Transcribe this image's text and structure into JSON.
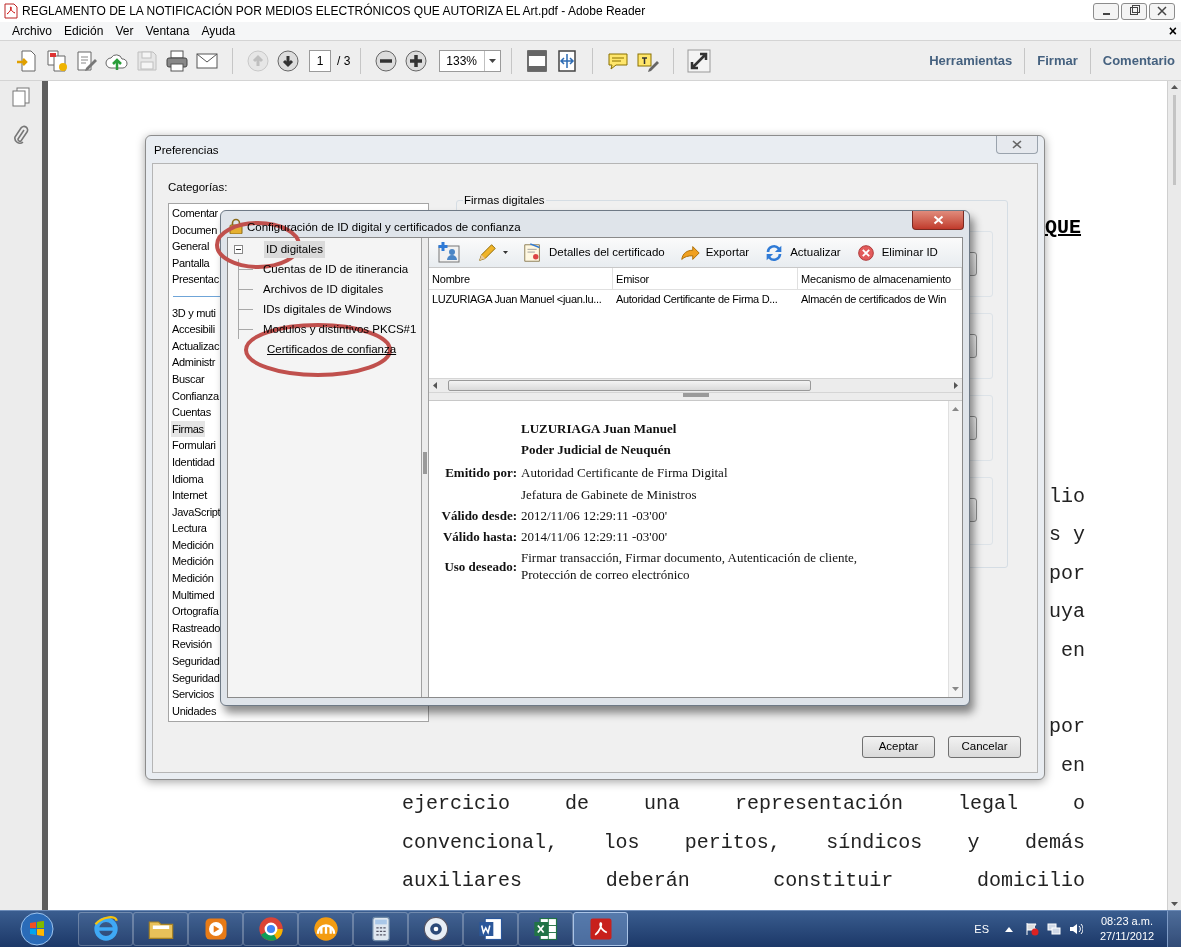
{
  "window": {
    "title": "REGLAMENTO DE LA NOTIFICACIÓN POR MEDIOS ELECTRÓNICOS QUE AUTORIZA EL Art.pdf - Adobe Reader"
  },
  "menu": [
    "Archivo",
    "Edición",
    "Ver",
    "Ventana",
    "Ayuda"
  ],
  "menu_close": "×",
  "toolbar": {
    "tools": [
      {
        "kind": "create",
        "disabled": false
      },
      {
        "kind": "combine",
        "disabled": false
      },
      {
        "kind": "edit",
        "disabled": false
      },
      {
        "kind": "share",
        "disabled": false
      },
      {
        "kind": "save",
        "disabled": true
      },
      {
        "kind": "print",
        "disabled": false
      },
      {
        "kind": "email",
        "disabled": false
      },
      {
        "kind": "prev",
        "disabled": true
      },
      {
        "kind": "next",
        "disabled": false
      },
      {
        "kind": "zoom_out",
        "disabled": false
      },
      {
        "kind": "zoom_in",
        "disabled": false
      },
      {
        "kind": "fit_page",
        "disabled": false
      },
      {
        "kind": "fit_width",
        "disabled": false
      },
      {
        "kind": "comment",
        "disabled": false
      },
      {
        "kind": "highlight",
        "disabled": false
      },
      {
        "kind": "fullscreen",
        "disabled": false
      }
    ],
    "page": "1",
    "page_count": "/ 3",
    "zoom": "133%",
    "panels": [
      "Herramientas",
      "Firmar",
      "Comentario"
    ]
  },
  "document": {
    "heading": "QUE",
    "lines": [
      {
        "kind": "fragment",
        "text": "lio"
      },
      {
        "kind": "fragment",
        "text": "s y"
      },
      {
        "kind": "fragment",
        "text": "por"
      },
      {
        "kind": "fragment",
        "text": "uya"
      },
      {
        "kind": "fragment",
        "text": "en"
      },
      {
        "kind": "blank"
      },
      {
        "kind": "fragment",
        "text": "por"
      },
      {
        "kind": "fragment",
        "text": "en"
      },
      {
        "kind": "line",
        "text": "ejercicio de una representación legal o"
      },
      {
        "kind": "line",
        "text": "convencional, los peritos, síndicos y demás"
      },
      {
        "kind": "line",
        "text": "auxiliares deberán constituir domicilio"
      }
    ]
  },
  "preferences": {
    "title": "Preferencias",
    "categories_label": "Categorías:",
    "category_groups": [
      {
        "items": [
          {
            "label": "Comentar",
            "selected": false
          },
          {
            "label": "Documen",
            "selected": false
          },
          {
            "label": "General",
            "selected": false
          },
          {
            "label": "Pantalla",
            "selected": false
          },
          {
            "label": "Presentac",
            "selected": false
          }
        ]
      },
      {
        "items": [
          {
            "label": "3D y muti",
            "selected": false
          },
          {
            "label": "Accesibili",
            "selected": false
          },
          {
            "label": "Actualizac",
            "selected": false
          },
          {
            "label": "Administr",
            "selected": false
          },
          {
            "label": "Buscar",
            "selected": false
          },
          {
            "label": "Confianza",
            "selected": false
          },
          {
            "label": "Cuentas",
            "selected": false
          },
          {
            "label": "Firmas",
            "selected": true
          },
          {
            "label": "Formulari",
            "selected": false
          },
          {
            "label": "Identidad",
            "selected": false
          },
          {
            "label": "Idioma",
            "selected": false
          },
          {
            "label": "Internet",
            "selected": false
          },
          {
            "label": "JavaScript",
            "selected": false
          },
          {
            "label": "Lectura",
            "selected": false
          },
          {
            "label": "Medición",
            "selected": false
          },
          {
            "label": "Medición",
            "selected": false
          },
          {
            "label": "Medición",
            "selected": false
          },
          {
            "label": "Multimed",
            "selected": false
          },
          {
            "label": "Ortografía",
            "selected": false
          },
          {
            "label": "Rastreado",
            "selected": false
          },
          {
            "label": "Revisión",
            "selected": false
          },
          {
            "label": "Seguridad",
            "selected": false
          },
          {
            "label": "Seguridad",
            "selected": false
          },
          {
            "label": "Servicios",
            "selected": false
          },
          {
            "label": "Unidades",
            "selected": false
          }
        ]
      }
    ],
    "group_title": "Firmas digitales",
    "buttons": [
      "Aceptar",
      "Cancelar"
    ]
  },
  "id_dialog": {
    "title": "Configuración de ID digital y certificados de confianza",
    "tree": [
      {
        "label": "ID digitales",
        "selected": true,
        "hovered": false,
        "expanded": true,
        "children": [
          {
            "label": "Cuentas de ID de itinerancia",
            "selected": false,
            "hovered": false
          },
          {
            "label": "Archivos de ID digitales",
            "selected": false,
            "hovered": false
          },
          {
            "label": "IDs digitales de Windows",
            "selected": false,
            "hovered": false
          },
          {
            "label": "Modulos y distintivos PKCS#1",
            "selected": false,
            "hovered": false
          }
        ]
      },
      {
        "label": "Certificados de confianza",
        "selected": false,
        "hovered": true
      }
    ],
    "toolbar": [
      {
        "kind": "add"
      },
      {
        "kind": "edit"
      },
      {
        "kind": "details",
        "label": "Detalles del certificado"
      },
      {
        "kind": "export",
        "label": "Exportar"
      },
      {
        "kind": "refresh",
        "label": "Actualizar"
      },
      {
        "kind": "delete",
        "label": "Eliminar ID"
      }
    ],
    "table": {
      "columns": [
        "Nombre",
        "Emisor",
        "Mecanismo de almacenamiento"
      ],
      "rows": [
        {
          "cells": [
            "LUZURIAGA Juan Manuel <juan.lu...",
            "Autoridad Certificante de Firma D...",
            "Almacén de certificados de Win"
          ]
        }
      ]
    },
    "details": {
      "headings": [
        "LUZURIAGA Juan Manuel",
        "Poder Judicial de Neuquén"
      ],
      "fields": [
        {
          "label": "Emitido por:",
          "values": [
            "Autoridad Certificante de Firma Digital",
            "Jefatura de Gabinete de Ministros"
          ]
        },
        {
          "label": "Válido desde:",
          "values": [
            "2012/11/06 12:29:11 -03'00'"
          ]
        },
        {
          "label": "Válido hasta:",
          "values": [
            "2014/11/06 12:29:11 -03'00'"
          ]
        },
        {
          "label": "Uso deseado:",
          "values": [
            "Firmar transacción, Firmar documento, Autenticación de cliente, Protección de correo electrónico"
          ]
        }
      ]
    }
  },
  "taskbar": {
    "apps": [
      {
        "kind": "ie",
        "selected": false
      },
      {
        "kind": "folder",
        "selected": false
      },
      {
        "kind": "media",
        "selected": false
      },
      {
        "kind": "chrome",
        "selected": false
      },
      {
        "kind": "sun",
        "selected": false
      },
      {
        "kind": "calculator",
        "selected": false
      },
      {
        "kind": "disc",
        "selected": false
      },
      {
        "kind": "word",
        "selected": false
      },
      {
        "kind": "excel",
        "selected": false
      },
      {
        "kind": "acrobat",
        "selected": true
      }
    ],
    "language": "ES",
    "time": "08:23 a.m.",
    "date": "27/11/2012"
  }
}
